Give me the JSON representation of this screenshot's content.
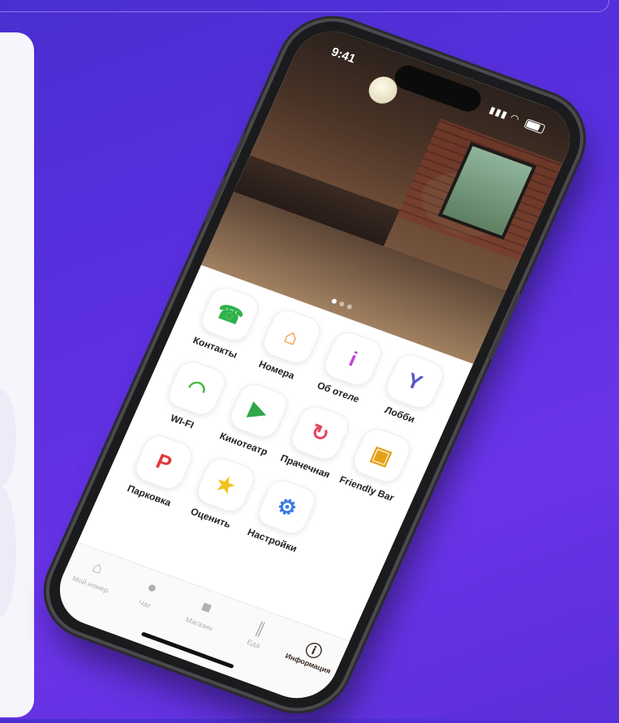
{
  "status": {
    "time": "9:41",
    "signal": "▮▮▮ ◠"
  },
  "services": [
    {
      "label": "Контакты",
      "icon": "phone-24-icon",
      "glyph": "☎",
      "color": "#2fb24a"
    },
    {
      "label": "Номера",
      "icon": "building-icon",
      "glyph": "⌂",
      "color": "#f08a1c"
    },
    {
      "label": "Об отеле",
      "icon": "info-icon",
      "glyph": "i",
      "color": "#c047d8"
    },
    {
      "label": "Лобби",
      "icon": "cocktail-icon",
      "glyph": "Y",
      "color": "#5a56c8"
    },
    {
      "label": "WI-FI",
      "icon": "wifi-icon",
      "glyph": "◠",
      "color": "#44b93c"
    },
    {
      "label": "Кинотеатр",
      "icon": "video-camera-icon",
      "glyph": "▶",
      "color": "#2fa84a"
    },
    {
      "label": "Прачечная",
      "icon": "refresh-icon",
      "glyph": "↻",
      "color": "#e4455a"
    },
    {
      "label": "Friendly Bar",
      "icon": "beer-mug-icon",
      "glyph": "▣",
      "color": "#e5a21a"
    },
    {
      "label": "Парковка",
      "icon": "parking-icon",
      "glyph": "P",
      "color": "#e23b3b"
    },
    {
      "label": "Оценить",
      "icon": "star-icon",
      "glyph": "★",
      "color": "#f2c21b"
    },
    {
      "label": "Настройки",
      "icon": "gear-icon",
      "glyph": "⚙",
      "color": "#3a7be0"
    }
  ],
  "tabs": [
    {
      "label": "Мой номер",
      "icon": "home-icon",
      "glyph": "⌂",
      "active": false
    },
    {
      "label": "Чат",
      "icon": "chat-bubble-icon",
      "glyph": "●",
      "active": false
    },
    {
      "label": "Магазин",
      "icon": "shopping-bag-icon",
      "glyph": "■",
      "active": false
    },
    {
      "label": "Еда",
      "icon": "fork-knife-icon",
      "glyph": "∥",
      "active": false
    },
    {
      "label": "Информация",
      "icon": "info-circle-icon",
      "glyph": "ⓘ",
      "active": true
    }
  ],
  "colors": {
    "background": "#5a2fe0",
    "active_tab": "#3a2a22"
  }
}
